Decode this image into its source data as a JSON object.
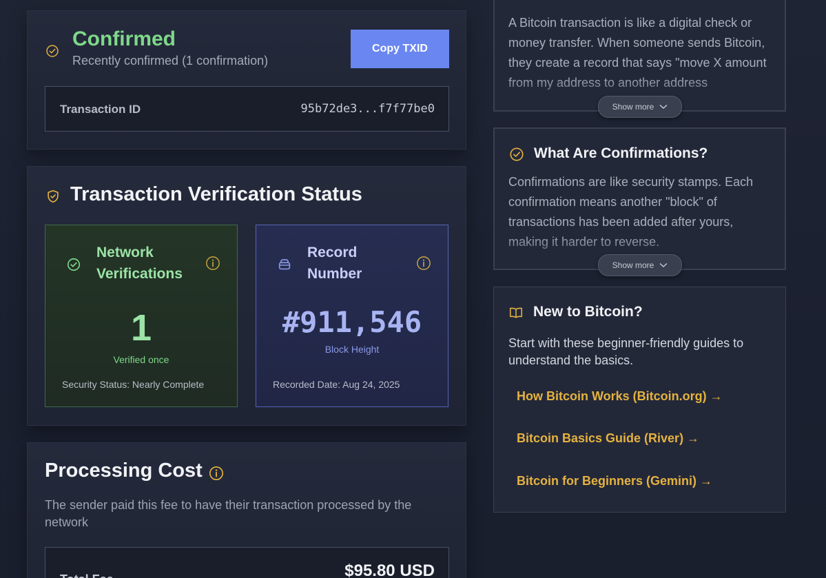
{
  "status": {
    "title": "Confirmed",
    "subtitle": "Recently confirmed (1 confirmation)",
    "copy_button": "Copy TXID",
    "txid_label": "Transaction ID",
    "txid_value": "95b72de3...f7f77be0"
  },
  "verification": {
    "title": "Transaction Verification Status",
    "network": {
      "title": "Network Verifications",
      "value": "1",
      "caption": "Verified once",
      "footer": "Security Status: Nearly Complete"
    },
    "record": {
      "title": "Record Number",
      "value": "#911,546",
      "caption": "Block Height",
      "footer": "Recorded Date: Aug 24, 2025"
    }
  },
  "cost": {
    "title": "Processing Cost",
    "description": "The sender paid this fee to have their transaction processed by the network",
    "fee_label": "Total Fee",
    "fee_value": "$95.80 USD"
  },
  "sidebar": {
    "bitcoin_text": "A Bitcoin transaction is like a digital check or money transfer. When someone sends Bitcoin, they create a record that says \"move X amount from my address to another address",
    "show_more": "Show more",
    "confirmations": {
      "title": "What Are Confirmations?",
      "text": "Confirmations are like security stamps. Each confirmation means another \"block\" of transactions has been added after yours, making it harder to reverse."
    },
    "new": {
      "title": "New to Bitcoin?",
      "description": "Start with these beginner-friendly guides to understand the basics.",
      "links": [
        "How Bitcoin Works (Bitcoin.org) →",
        "Bitcoin Basics Guide (River) →",
        "Bitcoin for Beginners (Gemini) →"
      ]
    }
  },
  "colors": {
    "accent_green": "#7fd88a",
    "accent_gold": "#e5b23f",
    "button_blue": "#6a86f0"
  }
}
